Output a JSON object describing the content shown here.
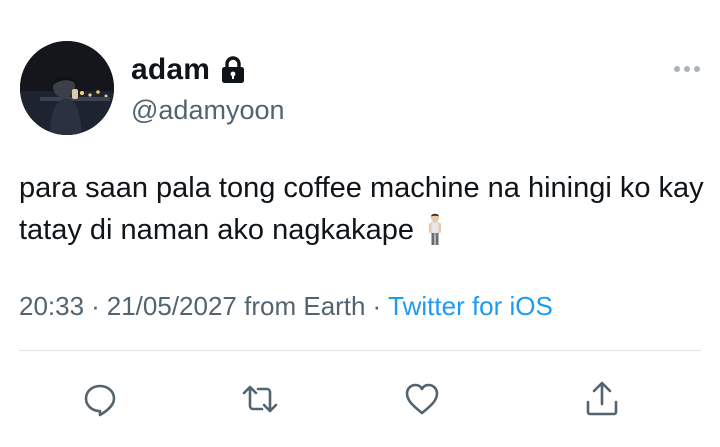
{
  "user": {
    "display_name": "adam",
    "handle": "@adamyoon",
    "avatar_icon": "avatar",
    "verified_icon": "lock-icon"
  },
  "tweet": {
    "text": "para saan pala tong coffee machine na hiningi ko kay tatay di naman ako nagkakape",
    "emoji": "person-standing-emoji",
    "time": "20:33",
    "date": "21/05/2027",
    "location": "from Earth",
    "separator": "·",
    "source": "Twitter for iOS"
  },
  "actions": [
    {
      "name": "reply-icon"
    },
    {
      "name": "retweet-icon"
    },
    {
      "name": "like-icon"
    },
    {
      "name": "share-icon"
    }
  ],
  "colors": {
    "text": "#0f1419",
    "secondary": "#536471",
    "link": "#1d9bf0",
    "divider": "#dfe3e6"
  }
}
